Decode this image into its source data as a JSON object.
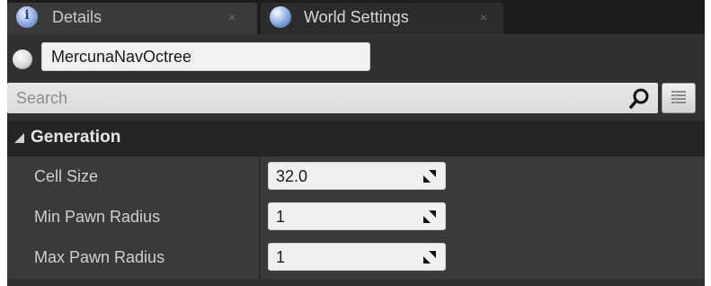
{
  "tabs": [
    {
      "label": "Details",
      "close": "×",
      "icon": "info-icon",
      "icon_glyph": "i",
      "active": true
    },
    {
      "label": "World Settings",
      "close": "×",
      "icon": "world-globe-icon",
      "active": false
    }
  ],
  "actor": {
    "icon": "sphere-actor-icon",
    "name": "MercunaNavOctree"
  },
  "search": {
    "placeholder": "Search",
    "icon": "search-icon",
    "view_options_icon": "view-options-icon"
  },
  "category": {
    "label": "Generation",
    "expanded": true,
    "icon": "collapse-arrow-icon"
  },
  "properties": [
    {
      "label": "Cell Size",
      "value": "32.0"
    },
    {
      "label": "Min Pawn Radius",
      "value": "1"
    },
    {
      "label": "Max Pawn Radius",
      "value": "1"
    }
  ],
  "colors": {
    "panel_bg": "#303030",
    "tab_bg": "#1d1d1d",
    "field_bg": "#f0f0f0",
    "category_bg": "#252525"
  }
}
